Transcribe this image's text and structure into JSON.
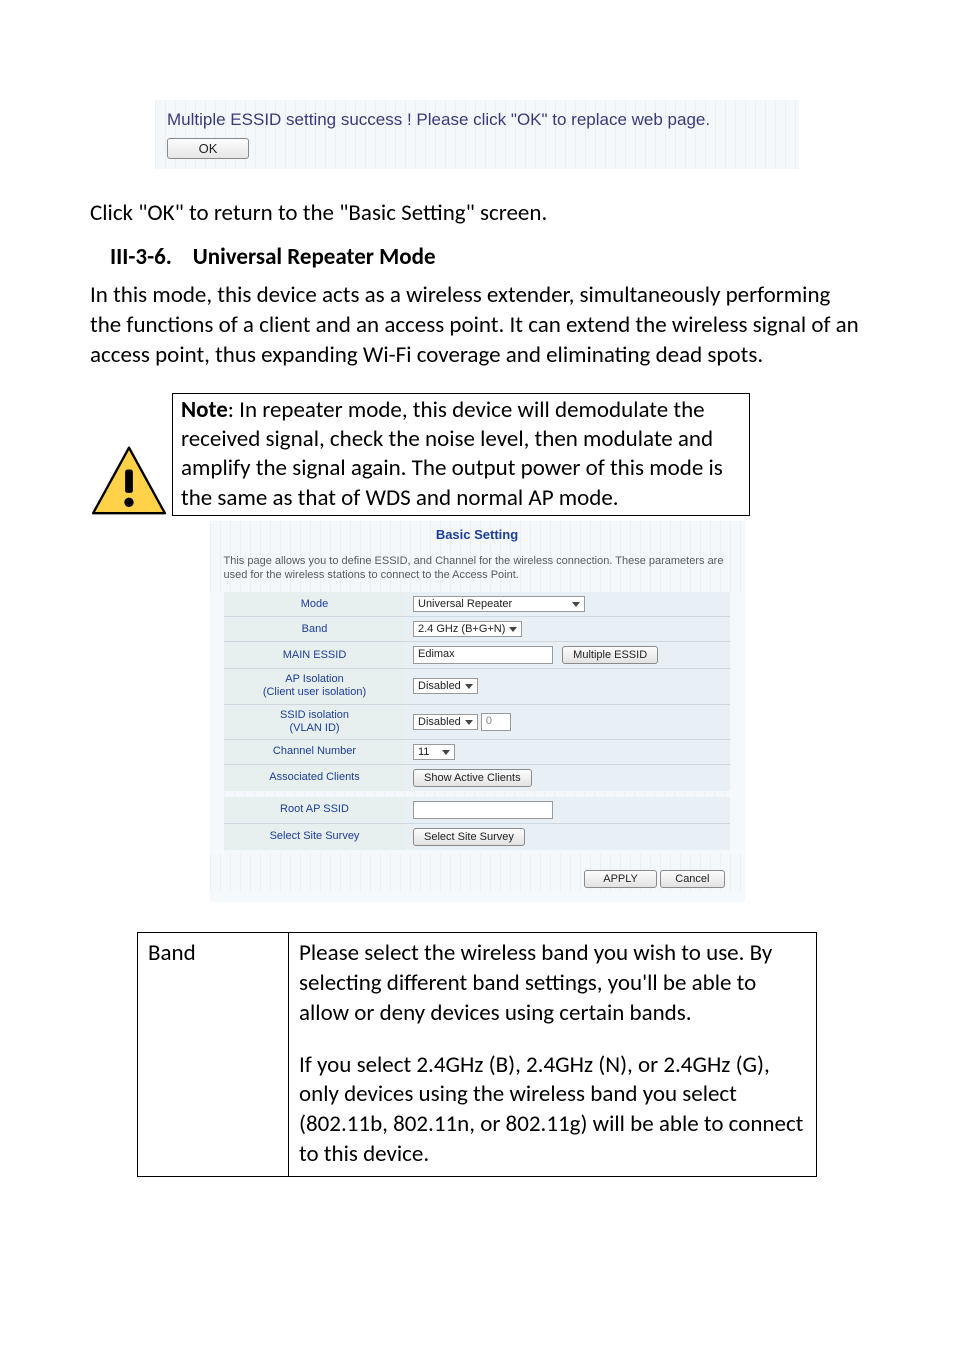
{
  "success": {
    "message": "Multiple ESSID setting success ! Please click \"OK\" to replace web page.",
    "ok_label": "OK"
  },
  "intro_line": "Click \"OK\" to return to the \"Basic Setting\" screen.",
  "section_number": "III-3-6.",
  "section_title": "Universal Repeater Mode",
  "mode_paragraph": "In this mode, this device acts as a wireless extender, simultaneously performing the functions of a client and an access point. It can extend the wireless signal of an access point, thus expanding Wi-Fi coverage and eliminating dead spots.",
  "note": {
    "bold": "Note",
    "text": ": In repeater mode, this device will demodulate the received signal, check the noise level, then modulate and amplify the signal again. The output power of this mode is the same as that of WDS and normal AP mode."
  },
  "panel": {
    "title": "Basic Setting",
    "desc": "This page allows you to define ESSID, and Channel for the wireless connection. These parameters are used for the wireless stations to connect to the Access Point.",
    "rows": {
      "mode_label": "Mode",
      "mode_value": "Universal Repeater",
      "band_label": "Band",
      "band_value": "2.4 GHz (B+G+N)",
      "main_essid_label": "MAIN ESSID",
      "main_essid_value": "Edimax",
      "multiple_essid_btn": "Multiple ESSID",
      "ap_iso_label_l1": "AP Isolation",
      "ap_iso_label_l2": "(Client user isolation)",
      "ap_iso_value": "Disabled",
      "ssid_iso_label_l1": "SSID isolation",
      "ssid_iso_label_l2": "(VLAN ID)",
      "ssid_iso_value": "Disabled",
      "ssid_iso_num": "0",
      "channel_label": "Channel Number",
      "channel_value": "11",
      "assoc_label": "Associated Clients",
      "assoc_btn": "Show Active Clients",
      "root_ssid_label": "Root AP SSID",
      "root_ssid_value": "",
      "survey_label": "Select Site Survey",
      "survey_btn": "Select Site Survey"
    },
    "apply_label": "APPLY",
    "cancel_label": "Cancel"
  },
  "band_table": {
    "left": "Band",
    "p1": "Please select the wireless band you wish to use. By selecting different band settings, you'll be able to allow or deny devices using certain bands.",
    "p2": "If you select 2.4GHz (B), 2.4GHz (N), or 2.4GHz (G), only devices using the wireless band you select (802.11b, 802.11n, or 802.11g) will be able to connect to this device."
  }
}
